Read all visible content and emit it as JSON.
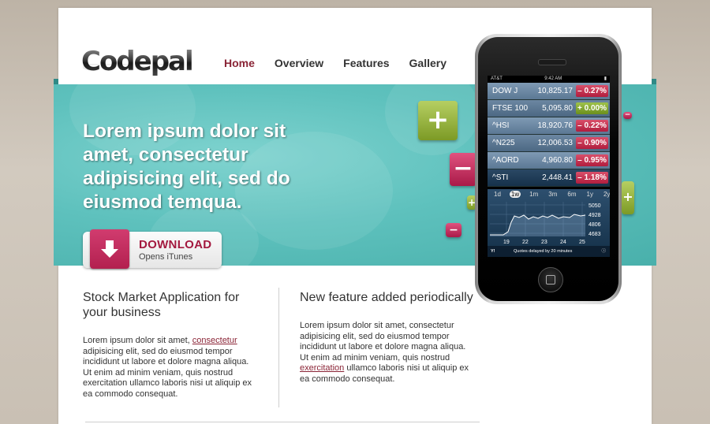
{
  "site": {
    "logo_text": "Codepal"
  },
  "nav": {
    "items": [
      "Home",
      "Overview",
      "Features",
      "Gallery"
    ],
    "active_index": 0
  },
  "hero": {
    "headline": "Lorem ipsum dolor sit amet, consectetur adipisicing elit, sed do eiusmod temqua.",
    "download_label": "DOWNLOAD",
    "download_sub": "Opens iTunes"
  },
  "phone": {
    "status": {
      "carrier": "AT&T",
      "time": "9:42 AM"
    },
    "stocks": [
      {
        "symbol": "DOW J",
        "price": "10,825.17",
        "change": "– 0.27%",
        "direction": "down"
      },
      {
        "symbol": "FTSE 100",
        "price": "5,095.80",
        "change": "+ 0.00%",
        "direction": "up"
      },
      {
        "symbol": "^HSI",
        "price": "18,920.76",
        "change": "– 0.22%",
        "direction": "down"
      },
      {
        "symbol": "^N225",
        "price": "12,006.53",
        "change": "– 0.90%",
        "direction": "down"
      },
      {
        "symbol": "^AORD",
        "price": "4,960.80",
        "change": "– 0.95%",
        "direction": "down"
      },
      {
        "symbol": "^STI",
        "price": "2,448.41",
        "change": "– 1.18%",
        "direction": "down"
      }
    ],
    "chart": {
      "ranges": [
        "1d",
        "1w",
        "1m",
        "3m",
        "6m",
        "1y",
        "2y"
      ],
      "selected_range": "1w",
      "y_ticks": [
        "5050",
        "4928",
        "4806",
        "4683"
      ],
      "x_ticks": [
        "19",
        "22",
        "23",
        "24",
        "25"
      ],
      "footer_text": "Quotes delayed by 20 minutes"
    }
  },
  "columns": [
    {
      "title": "Stock Market Application for your business",
      "text_before": "Lorem ipsum dolor sit amet, ",
      "link": "consectetur",
      "text_after": " adipisicing elit, sed do eiusmod tempor incididunt ut labore et dolore magna aliqua. Ut enim ad minim veniam, quis nostrud exercitation ullamco laboris nisi ut aliquip ex ea commodo consequat."
    },
    {
      "title": "New feature added periodically",
      "text_before": "Lorem ipsum dolor sit amet, consectetur adipisicing elit, sed do eiusmod tempor incididunt ut labore et dolore magna aliqua. Ut enim ad minim veniam, quis nostrud ",
      "link": "exercitation",
      "text_after": " ullamco laboris nisi ut aliquip ex ea commodo consequat."
    }
  ],
  "colors": {
    "accent": "#8a2436",
    "banner": "#5ec1bd",
    "download": "#b3204f"
  }
}
